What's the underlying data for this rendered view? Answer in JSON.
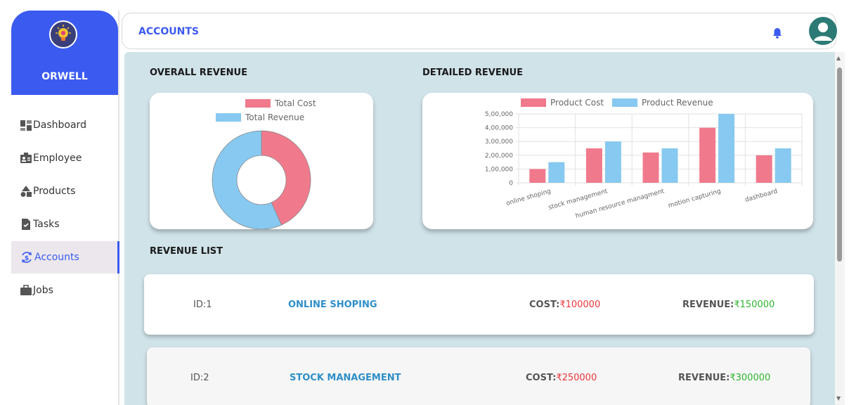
{
  "brand": {
    "name": "ORWELL"
  },
  "nav": [
    {
      "label": "Dashboard",
      "icon": "dashboard-icon",
      "active": false
    },
    {
      "label": "Employee",
      "icon": "employee-icon",
      "active": false
    },
    {
      "label": "Products",
      "icon": "products-icon",
      "active": false
    },
    {
      "label": "Tasks",
      "icon": "tasks-icon",
      "active": false
    },
    {
      "label": "Accounts",
      "icon": "accounts-icon",
      "active": true
    },
    {
      "label": "Jobs",
      "icon": "briefcase-icon",
      "active": false
    }
  ],
  "header": {
    "title": "ACCOUNTS"
  },
  "sections": {
    "overall": "OVERALL REVENUE",
    "detailed": "DETAILED REVENUE",
    "list": "REVENUE LIST"
  },
  "colors": {
    "accent": "#3b5af0",
    "cost": "#f07a8c",
    "revenue": "#87c9f0",
    "cost_text": "#e8363a",
    "revenue_text": "#2fb52f",
    "content_bg": "#d0e3e9"
  },
  "chart_data": [
    {
      "type": "pie",
      "legend": [
        "Total Cost",
        "Total Revenue"
      ],
      "values": [
        1300000,
        1700000
      ],
      "legend_position": "top"
    },
    {
      "type": "bar",
      "categories": [
        "online shoping",
        "stock management",
        "human resource managment",
        "motion capturing",
        "dashboard"
      ],
      "series": [
        {
          "name": "Product Cost",
          "values": [
            100000,
            250000,
            220000,
            400000,
            200000
          ]
        },
        {
          "name": "Product Revenue",
          "values": [
            150000,
            300000,
            250000,
            500000,
            250000
          ]
        }
      ],
      "yticks": [
        "0",
        "1,00,000",
        "2,00,000",
        "3,00,000",
        "4,00,000",
        "5,00,000"
      ],
      "ylim": [
        0,
        500000
      ],
      "grid": true,
      "legend_position": "top"
    }
  ],
  "revenue_list": [
    {
      "id": "ID:1",
      "name": "ONLINE SHOPING",
      "cost_label": "COST:",
      "cost": "₹100000",
      "revenue_label": "REVENUE:",
      "revenue": "₹150000"
    },
    {
      "id": "ID:2",
      "name": "STOCK MANAGEMENT",
      "cost_label": "COST:",
      "cost": "₹250000",
      "revenue_label": "REVENUE:",
      "revenue": "₹300000"
    }
  ]
}
